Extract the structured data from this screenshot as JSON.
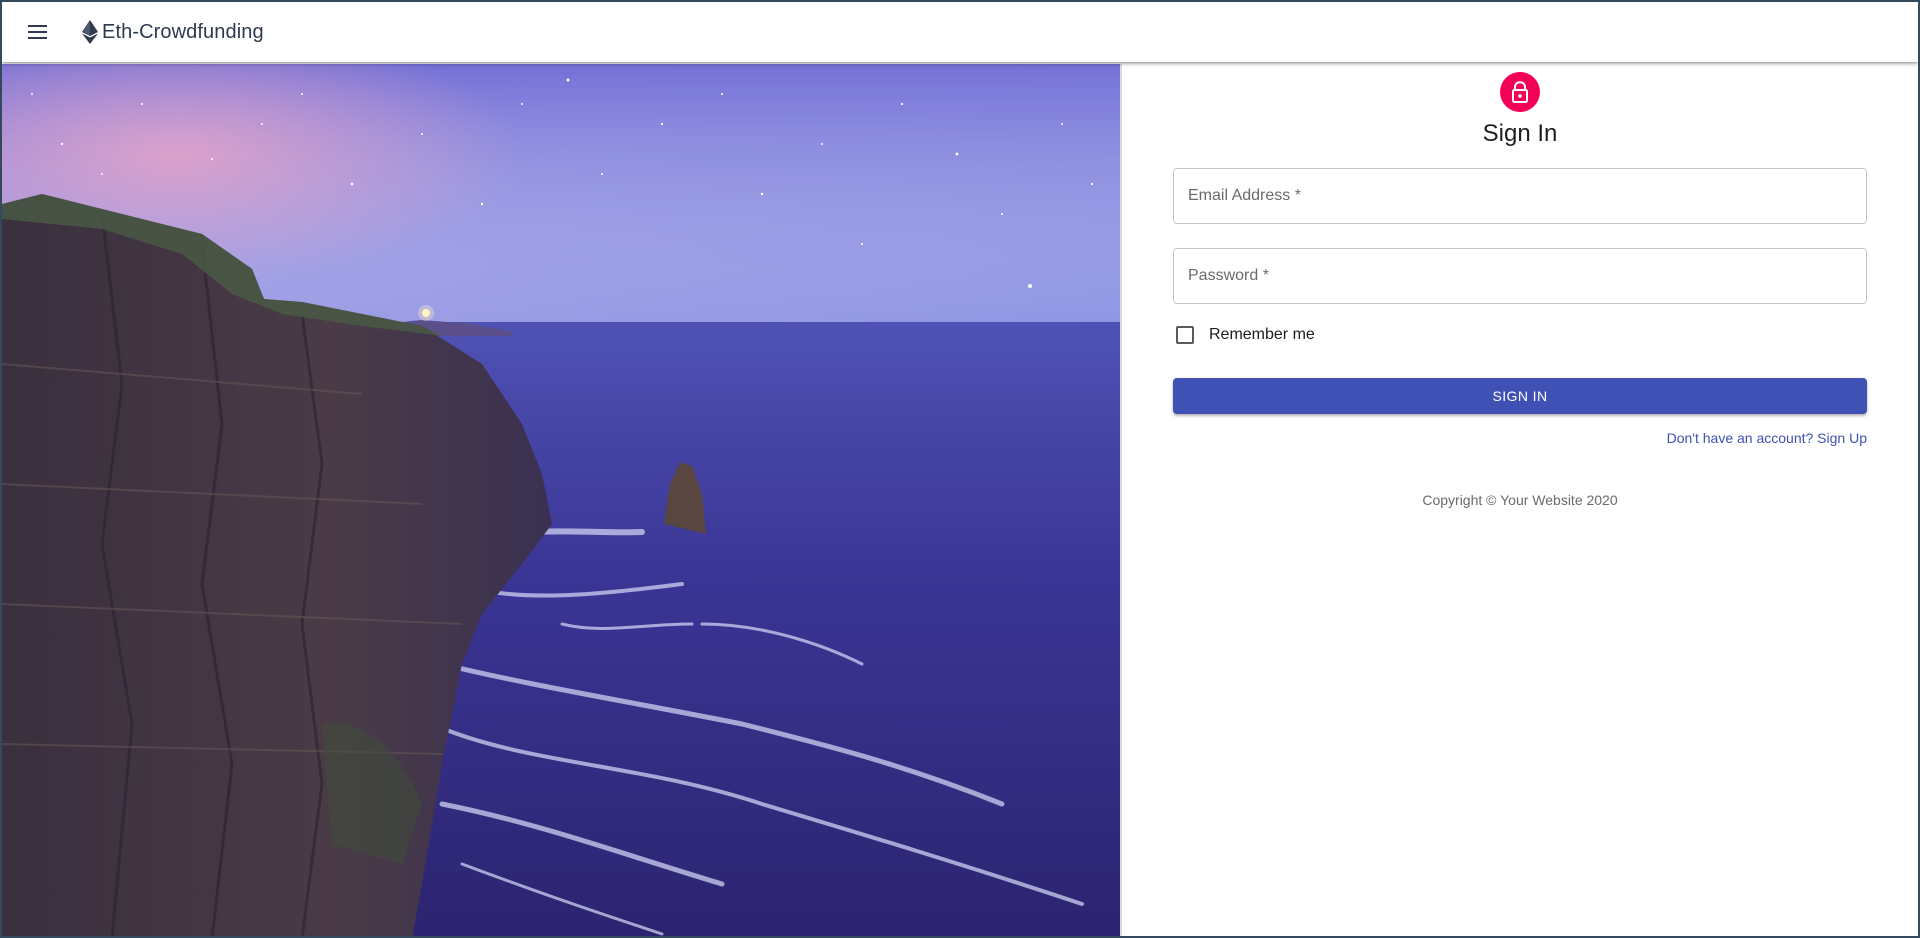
{
  "appbar": {
    "title": "Eth-Crowdfunding",
    "menu_icon": "hamburger-menu-icon",
    "logo_icon": "ethereum-icon"
  },
  "hero": {
    "image": "coastal-cliffs-at-dusk",
    "colors": {
      "sky_top": "#7a78d6",
      "sky_glow": "#d49ad6",
      "sea": "#3a3490",
      "cliff": "#3b2f3c"
    }
  },
  "signin": {
    "avatar_icon": "lock-icon",
    "avatar_color": "#f50057",
    "heading": "Sign In",
    "email": {
      "placeholder": "Email Address *",
      "value": ""
    },
    "password": {
      "placeholder": "Password *",
      "value": ""
    },
    "remember_label": "Remember me",
    "remember_checked": false,
    "submit_label": "SIGN IN",
    "submit_color": "#3f51b5",
    "signup_link": "Don't have an account? Sign Up",
    "copyright": "Copyright © Your Website 2020"
  }
}
